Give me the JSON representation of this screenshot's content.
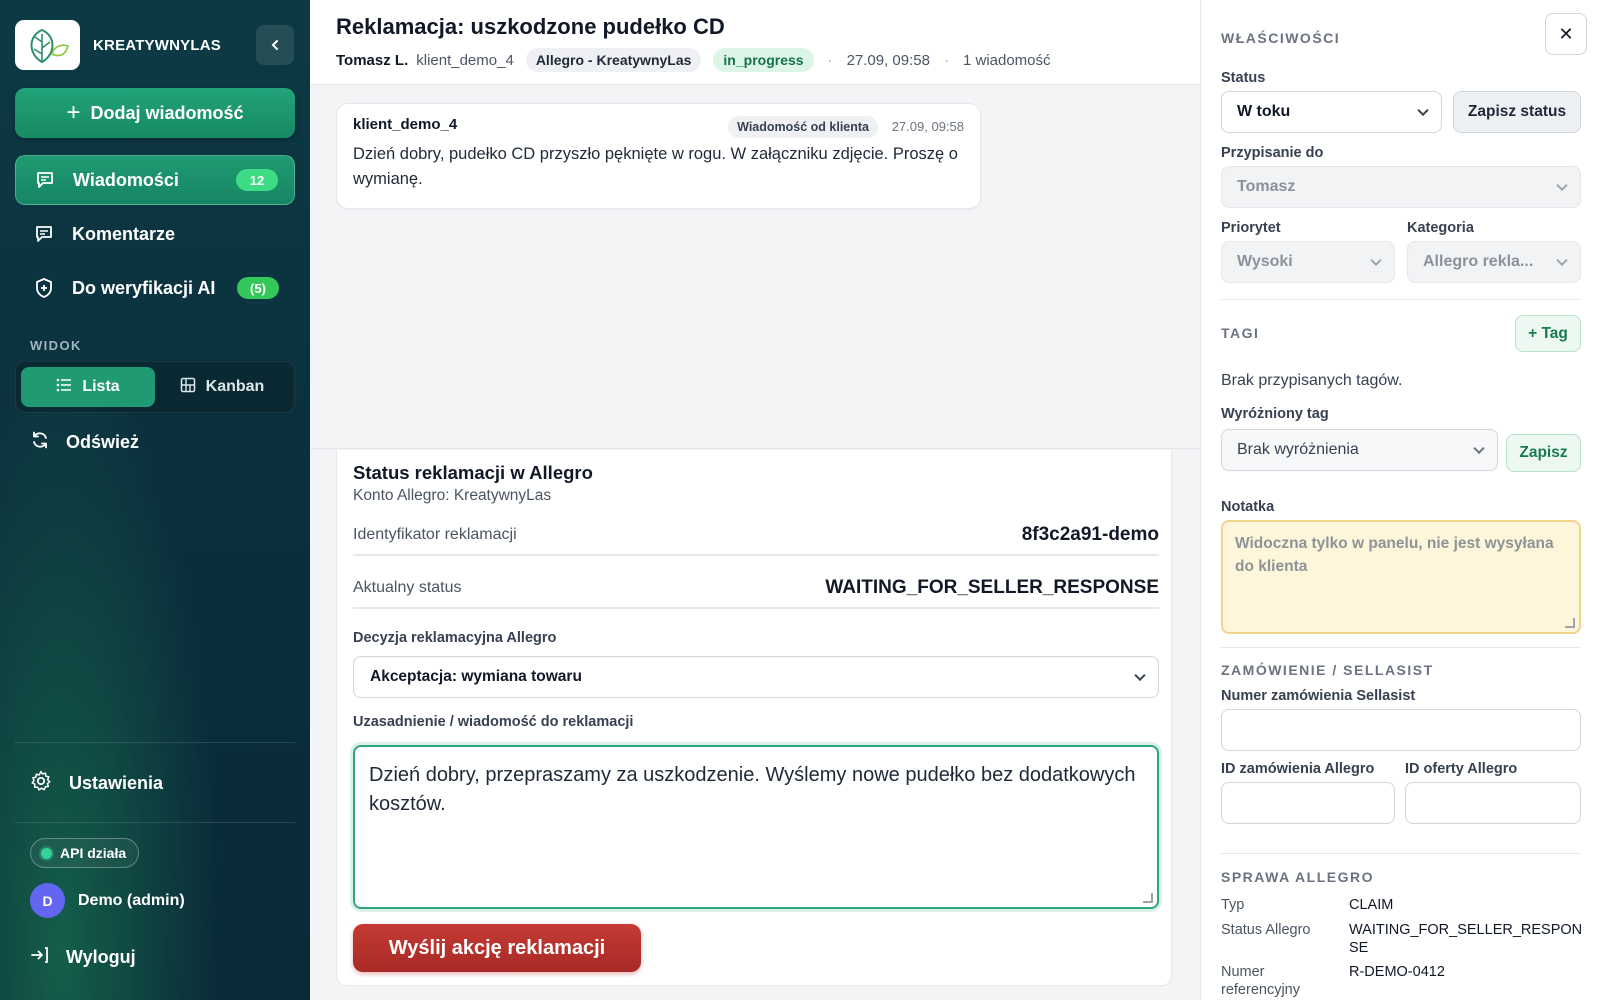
{
  "sidebar": {
    "brand": "KREATYWNYLAS",
    "add_button": "Dodaj wiadomość",
    "nav": [
      {
        "label": "Wiadomości",
        "badge": "12"
      },
      {
        "label": "Komentarze"
      },
      {
        "label": "Do weryfikacji AI",
        "badge": "(5)"
      }
    ],
    "view_label": "WIDOK",
    "views": [
      "Lista",
      "Kanban"
    ],
    "refresh": "Odśwież",
    "settings": "Ustawienia",
    "api_status": "API działa",
    "user_initial": "D",
    "user_name": "Demo (admin)",
    "logout": "Wyloguj"
  },
  "conversation": {
    "title": "Reklamacja: uszkodzone pudełko CD",
    "author": "Tomasz L.",
    "client": "klient_demo_4",
    "channel": "Allegro - KreatywnyLas",
    "state": "in_progress",
    "date": "27.09, 09:58",
    "message_count": "1 wiadomość",
    "message": {
      "sender": "klient_demo_4",
      "tag": "Wiadomość od klienta",
      "time": "27.09, 09:58",
      "body": "Dzień dobry, pudełko CD przyszło pęknięte w rogu. W załączniku zdjęcie. Proszę o wymianę."
    }
  },
  "claim": {
    "title": "Status reklamacji w Allegro",
    "account": "Konto Allegro: KreatywnyLas",
    "id_label": "Identyfikator reklamacji",
    "id_value": "8f3c2a91-demo",
    "status_label": "Aktualny status",
    "status_value": "WAITING_FOR_SELLER_RESPONSE",
    "decision_label": "Decyzja reklamacyjna Allegro",
    "decision_value": "Akceptacja: wymiana towaru",
    "reason_label": "Uzasadnienie / wiadomość do reklamacji",
    "reason_value": "Dzień dobry, przepraszamy za uszkodzenie. Wyślemy nowe pudełko bez dodatkowych kosztów.",
    "send_button": "Wyślij akcję reklamacji"
  },
  "properties": {
    "section": "WŁAŚCIWOŚCI",
    "close": "✕",
    "status_label": "Status",
    "status_value": "W toku",
    "save_status": "Zapisz status",
    "assign_label": "Przypisanie do",
    "assign_value": "Tomasz",
    "priority_label": "Priorytet",
    "priority_value": "Wysoki",
    "category_label": "Kategoria",
    "category_value": "Allegro rekla...",
    "tags_section": "TAGI",
    "add_tag": "+ Tag",
    "no_tags": "Brak przypisanych tagów.",
    "featured_label": "Wyróżniony tag",
    "featured_value": "Brak wyróżnienia",
    "featured_save": "Zapisz",
    "note_label": "Notatka",
    "note_placeholder": "Widoczna tylko w panelu, nie jest wysyłana do klienta",
    "order_section": "ZAMÓWIENIE / SELLASIST",
    "sellasist_label": "Numer zamówienia Sellasist",
    "allegro_order_label": "ID zamówienia Allegro",
    "allegro_offer_label": "ID oferty Allegro",
    "case_section": "SPRAWA ALLEGRO",
    "case": [
      {
        "k": "Typ",
        "v": "CLAIM"
      },
      {
        "k": "Status Allegro",
        "v": "WAITING_FOR_SELLER_RESPONSE"
      },
      {
        "k": "Numer referencyjny",
        "v": "R-DEMO-0412"
      }
    ]
  },
  "colors": {
    "sidebar_bg": "#0b2f3d",
    "accent_green": "#1f9a72",
    "danger": "#b8302c",
    "note_bg": "#fdf6da"
  }
}
